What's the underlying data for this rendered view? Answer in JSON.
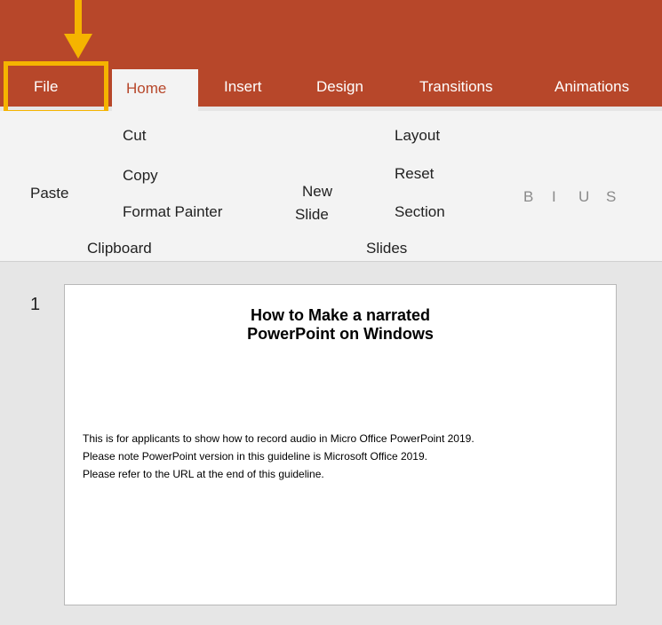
{
  "ribbon": {
    "tabs": [
      "File",
      "Home",
      "Insert",
      "Design",
      "Transitions",
      "Animations"
    ],
    "clipboard": {
      "cut": "Cut",
      "copy": "Copy",
      "format_painter": "Format Painter",
      "paste": "Paste",
      "group": "Clipboard"
    },
    "slides": {
      "layout": "Layout",
      "reset": "Reset",
      "section": "Section",
      "new": "New",
      "slide": "Slide",
      "group": "Slides"
    },
    "font_buttons": [
      "B",
      "I",
      "U",
      "S"
    ]
  },
  "slide": {
    "number": "1",
    "title_line1": "How to Make a narrated",
    "title_line2": "PowerPoint on Windows",
    "bullets": [
      "This is for applicants to show how to record audio in Micro Office PowerPoint 2019.",
      "Please note PowerPoint version in this guideline is Microsoft Office 2019.",
      "Please refer to the URL at the end of this guideline."
    ]
  },
  "colors": {
    "ribbon_accent": "#b7472a",
    "highlight": "#f5b400"
  }
}
